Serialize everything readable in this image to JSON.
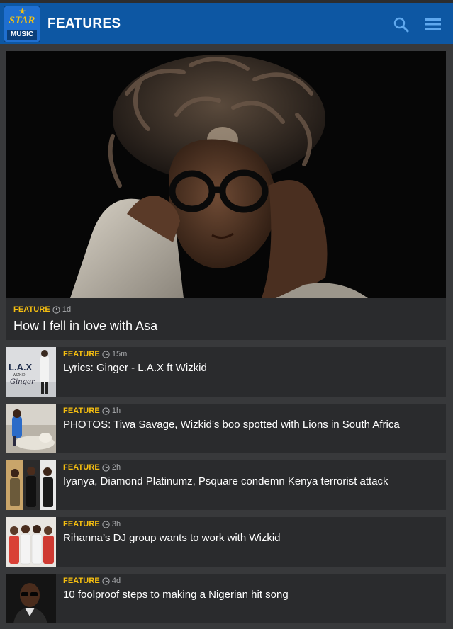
{
  "header": {
    "logo_star": "STAR",
    "logo_music": "MUSIC",
    "title": "FEATURES",
    "search_icon": "search-icon",
    "menu_icon": "hamburger-menu-icon",
    "bg_color": "#0d57a3"
  },
  "hero": {
    "tag": "FEATURE",
    "time": "1d",
    "title": "How I fell in love with Asa"
  },
  "articles": [
    {
      "tag": "FEATURE",
      "time": "15m",
      "title": "Lyrics: Ginger - L.A.X ft Wizkid",
      "thumb_text": "L.A.X",
      "thumb_sub": "WIZKID",
      "thumb_script": "Ginger"
    },
    {
      "tag": "FEATURE",
      "time": "1h",
      "title": "PHOTOS: Tiwa Savage, Wizkid’s boo spotted with Lions in South Africa"
    },
    {
      "tag": "FEATURE",
      "time": "2h",
      "title": "Iyanya, Diamond Platinumz, Psquare condemn Kenya terrorist attack"
    },
    {
      "tag": "FEATURE",
      "time": "3h",
      "title": "Rihanna’s DJ group wants to work with Wizkid"
    },
    {
      "tag": "FEATURE",
      "time": "4d",
      "title": "10 foolproof steps to making a Nigerian hit song"
    }
  ],
  "colors": {
    "tag": "#f6bf10",
    "card_bg": "#2a2b2d",
    "page_bg": "#38393b"
  }
}
